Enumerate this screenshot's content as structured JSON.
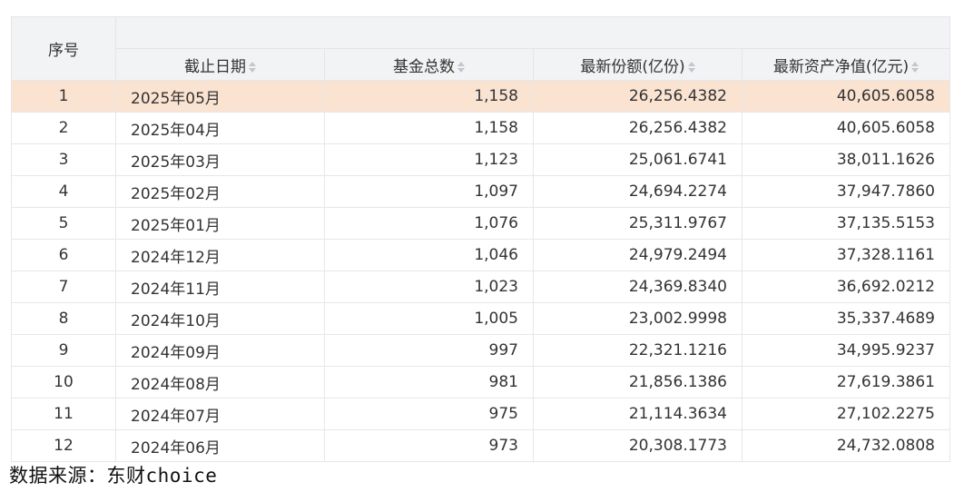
{
  "table": {
    "headers": {
      "index": "序号",
      "date": "截止日期",
      "fund_count": "基金总数",
      "latest_share": "最新份额(亿份)",
      "latest_nav": "最新资产净值(亿元)"
    },
    "rows": [
      {
        "index": "1",
        "date": "2025年05月",
        "fund_count": "1,158",
        "latest_share": "26,256.4382",
        "latest_nav": "40,605.6058"
      },
      {
        "index": "2",
        "date": "2025年04月",
        "fund_count": "1,158",
        "latest_share": "26,256.4382",
        "latest_nav": "40,605.6058"
      },
      {
        "index": "3",
        "date": "2025年03月",
        "fund_count": "1,123",
        "latest_share": "25,061.6741",
        "latest_nav": "38,011.1626"
      },
      {
        "index": "4",
        "date": "2025年02月",
        "fund_count": "1,097",
        "latest_share": "24,694.2274",
        "latest_nav": "37,947.7860"
      },
      {
        "index": "5",
        "date": "2025年01月",
        "fund_count": "1,076",
        "latest_share": "25,311.9767",
        "latest_nav": "37,135.5153"
      },
      {
        "index": "6",
        "date": "2024年12月",
        "fund_count": "1,046",
        "latest_share": "24,979.2494",
        "latest_nav": "37,328.1161"
      },
      {
        "index": "7",
        "date": "2024年11月",
        "fund_count": "1,023",
        "latest_share": "24,369.8340",
        "latest_nav": "36,692.0212"
      },
      {
        "index": "8",
        "date": "2024年10月",
        "fund_count": "1,005",
        "latest_share": "23,002.9998",
        "latest_nav": "35,337.4689"
      },
      {
        "index": "9",
        "date": "2024年09月",
        "fund_count": "997",
        "latest_share": "22,321.1216",
        "latest_nav": "34,995.9237"
      },
      {
        "index": "10",
        "date": "2024年08月",
        "fund_count": "981",
        "latest_share": "21,856.1386",
        "latest_nav": "27,619.3861"
      },
      {
        "index": "11",
        "date": "2024年07月",
        "fund_count": "975",
        "latest_share": "21,114.3634",
        "latest_nav": "27,102.2275"
      },
      {
        "index": "12",
        "date": "2024年06月",
        "fund_count": "973",
        "latest_share": "20,308.1773",
        "latest_nav": "24,732.0808"
      }
    ],
    "highlighted_row_color": "#fbe3d2",
    "header_bg_color": "#f2f3f5"
  },
  "icons": {
    "sort": "sort-icon"
  },
  "source_note": "数据来源：东财choice"
}
